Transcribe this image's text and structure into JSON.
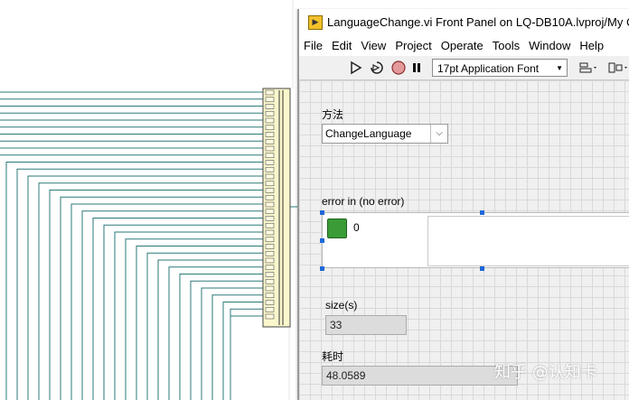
{
  "window": {
    "title": "LanguageChange.vi Front Panel on LQ-DB10A.lvproj/My C",
    "menu": [
      "File",
      "Edit",
      "View",
      "Project",
      "Operate",
      "Tools",
      "Window",
      "Help"
    ],
    "toolbar": {
      "font": "17pt Application Font",
      "icons": [
        "run-arrow-icon",
        "run-continuously-icon",
        "abort-icon",
        "pause-icon",
        "align-icon",
        "distribute-icon"
      ]
    }
  },
  "panel": {
    "method_label": "方法",
    "method_value": "ChangeLanguage",
    "error_label": "error in (no error)",
    "error_status": "ok",
    "error_code": "0",
    "size_label": "size(s)",
    "size_value": "33",
    "elapsed_label": "耗时",
    "elapsed_value": "48.0589"
  },
  "colors": {
    "wire": "#2b7a78",
    "led": "#3a9c36",
    "selection": "#1e68d8"
  },
  "watermark": "知乎 @认知卡"
}
